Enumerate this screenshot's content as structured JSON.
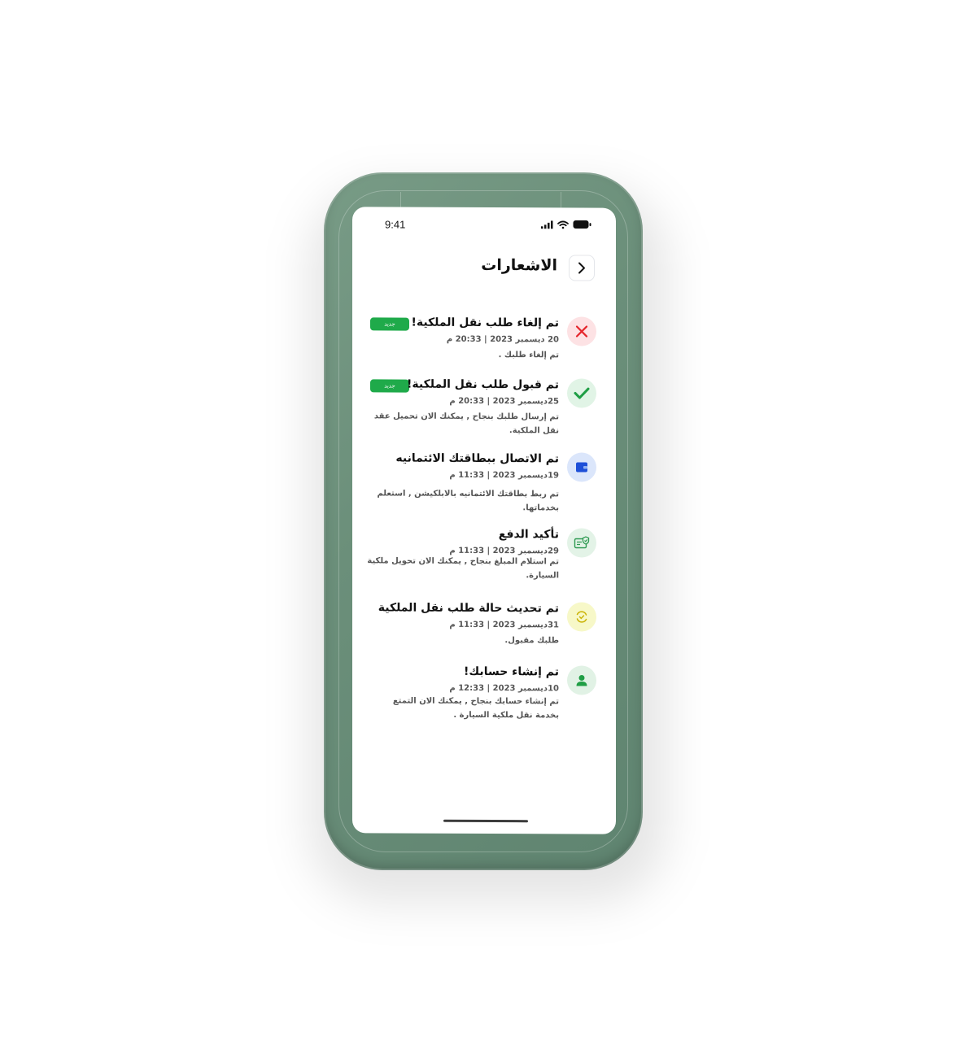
{
  "status_bar": {
    "time": "9:41"
  },
  "header": {
    "title": "الاشعارات",
    "back_icon": "chevron-right-icon"
  },
  "colors": {
    "phone_case": "#6b8f7a",
    "badge_green": "#1faa4a",
    "cancel_bg": "#fde2e4",
    "cancel_icon": "#e5252b",
    "accept_bg": "#e1f4e6",
    "accept_icon": "#1f9e45",
    "card_bg": "#dbe6fb",
    "card_icon": "#1d4fd8",
    "payment_bg": "#e3f3e7",
    "update_bg": "#f7f8c8",
    "account_bg": "#e1f2e5"
  },
  "notifications": [
    {
      "title": "تم إلغاء طلب نقل الملكية!",
      "date": "20 ديسمبر 2023 | 20:33 م",
      "body": "تم إلغاء طلبك .",
      "badge": "جديد",
      "icon": "x-cancel-icon"
    },
    {
      "title": "تم قبول طلب نقل الملكية!",
      "date": "25ديسمبر 2023 | 20:33 م",
      "body": "تم إرسال طلبك بنجاح , يمكنك الان تحميل عقد نقل الملكية.",
      "badge": "جديد",
      "icon": "checkmark-icon"
    },
    {
      "title": "تم الاتصال ببطاقتك الائتمانيه",
      "date": "19ديسمبر 2023 | 11:33 م",
      "body": "تم ربط بطاقتك الائتمانيه بالابلكيشن , استعلم بخدماتها.",
      "icon": "wallet-card-icon"
    },
    {
      "title": "تأكيد الدفع",
      "date": "29ديسمبر 2023 | 11:33 م",
      "body": "تم استلام المبلغ بنجاح , يمكنك الان تحويل ملكية السيارة.",
      "icon": "payment-verified-icon"
    },
    {
      "title": "تم تحديث حالة طلب نقل الملكية",
      "date": "31ديسمبر 2023 | 11:33 م",
      "body": "طلبك مقبول.",
      "icon": "refresh-status-icon"
    },
    {
      "title": "تم إنشاء حسابك!",
      "date": "10ديسمبر 2023 | 12:33 م",
      "body": "تم إنشاء حسابك بنجاح , يمكنك الان التمتع بخدمة نقل ملكية السيارة .",
      "icon": "user-icon"
    }
  ]
}
